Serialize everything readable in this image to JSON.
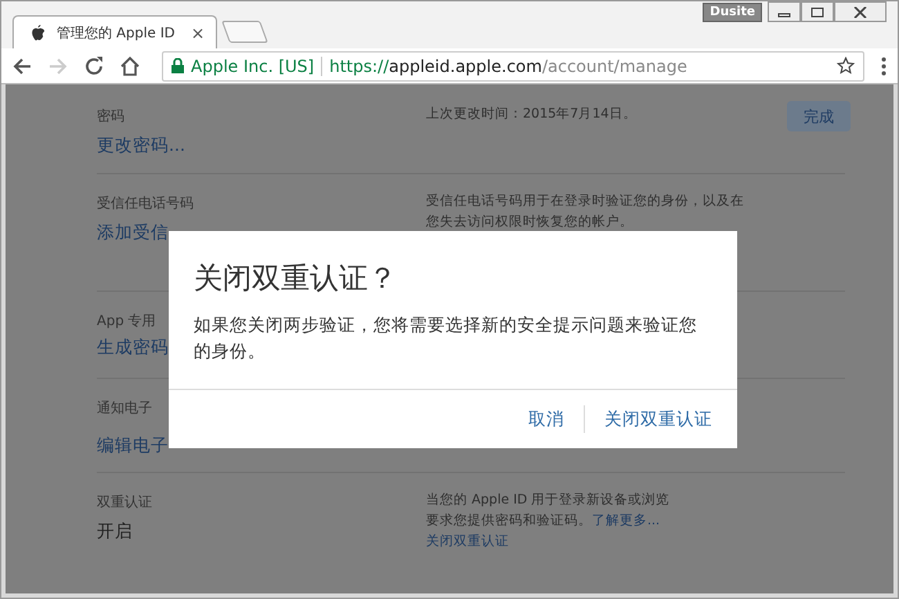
{
  "browser": {
    "profile_badge": "Dusite",
    "tab_title": "管理您的 Apple ID",
    "close_tab": "×",
    "address": {
      "secure_label": "Apple Inc. [US]",
      "scheme": "https://",
      "host": "appleid.apple.com",
      "path": "/account/manage"
    }
  },
  "page": {
    "done_button": "完成",
    "sections": [
      {
        "label": "密码",
        "action": "更改密码...",
        "kind": "link",
        "info": [
          "上次更改时间：2015年7月14日。"
        ]
      },
      {
        "label": "受信任电话号码",
        "action": "添加受信",
        "kind": "link",
        "info": [
          "受信任电话号码用于在登录时验证您的身份，以及在",
          "您失去访问权限时恢复您的帐户。"
        ]
      },
      {
        "label": "App 专用",
        "action": "生成密码",
        "kind": "link"
      },
      {
        "label": "通知电子",
        "action": "编辑电子",
        "kind": "link"
      },
      {
        "label": "双重认证",
        "action": "开启",
        "kind": "status",
        "info": [
          "当您的 Apple ID 用于登录新设备或浏览"
        ],
        "info_extra": {
          "text": "要求您提供密码和验证码。",
          "link": "了解更多..."
        },
        "info_link": "关闭双重认证"
      }
    ]
  },
  "dialog": {
    "title": "关闭双重认证？",
    "message": "如果您关闭两步验证，您将需要选择新的安全提示问题来验证您的身份。",
    "buttons": [
      {
        "label": "取消"
      },
      {
        "label": "关闭双重认证"
      }
    ]
  }
}
